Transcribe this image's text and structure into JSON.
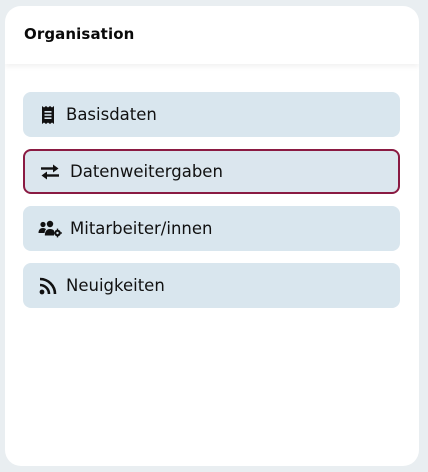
{
  "panel": {
    "title": "Organisation"
  },
  "nav": {
    "items": [
      {
        "label": "Basisdaten",
        "icon": "receipt-icon",
        "active": false
      },
      {
        "label": "Datenweitergaben",
        "icon": "swap-arrows-icon",
        "active": true
      },
      {
        "label": "Mitarbeiter/innen",
        "icon": "users-gear-icon",
        "active": false
      },
      {
        "label": "Neuigkeiten",
        "icon": "rss-icon",
        "active": false
      }
    ]
  },
  "colors": {
    "page_background": "#e9eef1",
    "panel_background": "#ffffff",
    "nav_item_background": "#d9e6ee",
    "active_border": "#8a1a42",
    "text": "#111111"
  }
}
